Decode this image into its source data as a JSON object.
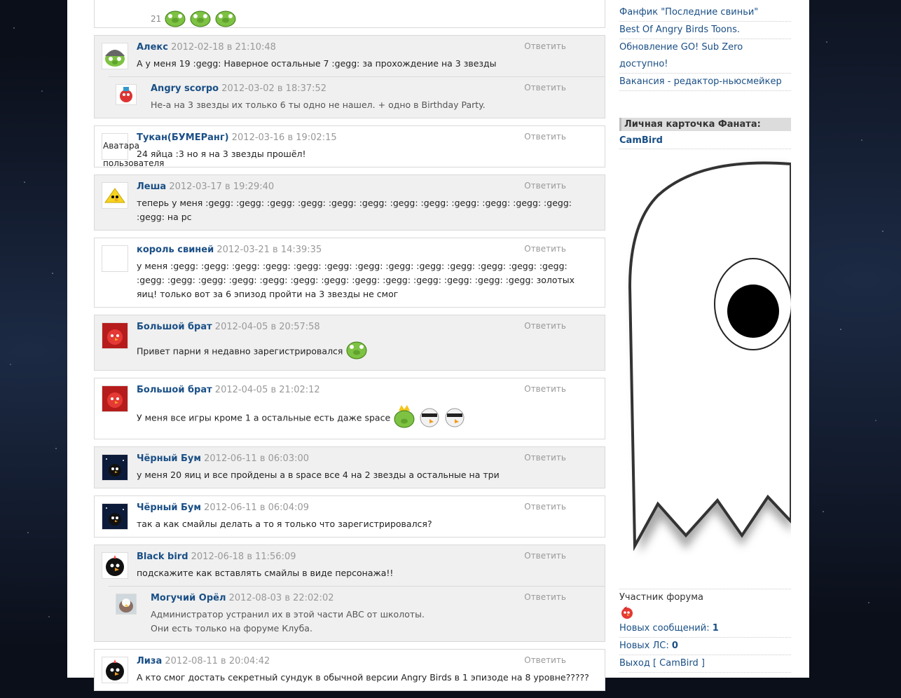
{
  "reply_label": "Ответить",
  "colors": {
    "link": "#1a4f86",
    "date": "#999999",
    "panel": "#f0f0f0"
  },
  "top": {
    "count": "21"
  },
  "comments": [
    {
      "author": "Алекс",
      "date": "2012-02-18 в 21:10:48",
      "text": "А у меня 19 :gegg: Наверное остальные 7 :gegg: за прохождение на 3 звезды",
      "avatar": "helmet-pig-avatar"
    },
    {
      "author": "Angry scorpo",
      "date": "2012-03-02 в 18:37:52",
      "text": "Не-а на 3 звезды их только 6 ты одно не нашел. + одно в Birthday Party.",
      "avatar": "birthday-bird-avatar"
    },
    {
      "author": "Тукан(БУМЕРанг)",
      "date": "2012-03-16 в 19:02:15",
      "text": "24 яйца :3 но я на 3 звезды прошёл!",
      "avatar_text": "Аватара пользователя"
    },
    {
      "author": "Леша",
      "date": "2012-03-17 в 19:29:40",
      "text": "теперь у меня :gegg: :gegg: :gegg: :gegg: :gegg: :gegg: :gegg: :gegg: :gegg: :gegg: :gegg: :gegg: :gegg: на pc",
      "avatar": "yellow-bird-avatar"
    },
    {
      "author": "король свиней",
      "date": "2012-03-21 в 14:39:35",
      "text": "у меня :gegg: :gegg: :gegg: :gegg: :gegg: :gegg: :gegg: :gegg: :gegg: :gegg: :gegg: :gegg: :gegg: :gegg: :gegg: :gegg: :gegg: :gegg: :gegg: :gegg: :gegg: :gegg: :gegg: :gegg: :gegg: :gegg: золотых яиц! только вот за 6 эпизод пройти на 3 звезды не смог",
      "avatar": "empty-avatar"
    },
    {
      "author": "Большой брат",
      "date": "2012-04-05 в 20:57:58",
      "text": "Привет парни я недавно зарегистрировался",
      "avatar": "red-bird-avatar"
    },
    {
      "author": "Большой брат",
      "date": "2012-04-05 в 21:02:12",
      "text": "У меня все игры кроме 1 а остальные есть даже space",
      "avatar": "red-bird-avatar"
    },
    {
      "author": "Чёрный Бум",
      "date": "2012-06-11 в 06:03:00",
      "text": "у меня 20 яиц и все пройдены а в space все 4 на 2 звезды а остальные на три",
      "avatar": "black-bird-night-avatar"
    },
    {
      "author": "Чёрный Бум",
      "date": "2012-06-11 в 06:04:09",
      "text": "так а как смайлы делать а то я только что зарегистрировался?",
      "avatar": "black-bird-night-avatar"
    },
    {
      "author": "Black bird",
      "date": "2012-06-18 в 11:56:09",
      "text": "подскажите как вставлять смайлы в виде персонажа!!",
      "avatar": "black-bird-avatar"
    },
    {
      "author": "Могучий Орёл",
      "date": "2012-08-03 в 22:02:02",
      "text": "Администратор устранил их в этой части ABC от школоты.",
      "text2": "Они есть только на форуме Клуба.",
      "avatar": "eagle-avatar"
    },
    {
      "author": "Лиза",
      "date": "2012-08-11 в 20:04:42",
      "text": "А кто смог достать секретный сундук в обычной версии Angry Birds в 1 эпизоде на 8 уровне?????",
      "avatar": "black-bird-avatar"
    }
  ],
  "sidebar": {
    "links": [
      "Фанфик \"Последние свиньи\"",
      "Best Of Angry Birds Toons.",
      "Обновление GO! Sub Zero доступно!",
      "Вакансия - редактор-ньюсмейкер"
    ],
    "card_title": "Личная карточка Фаната:",
    "username": "CamBird",
    "role": "Участник форума",
    "new_messages_label": "Новых сообщений:",
    "new_messages_value": "1",
    "new_pm_label": "Новых ЛС:",
    "new_pm_value": "0",
    "logout_label": "Выход [ CamBird ]"
  }
}
